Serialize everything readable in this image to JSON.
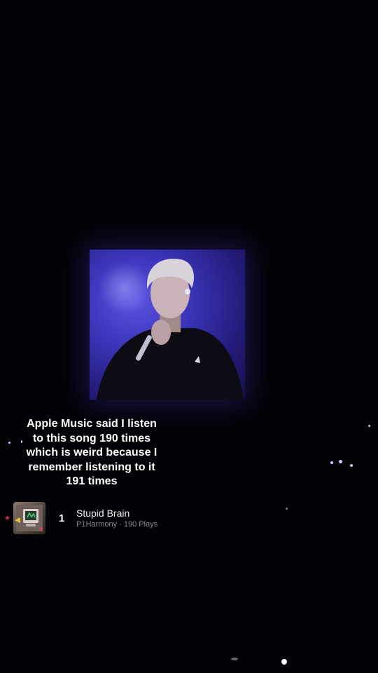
{
  "caption": {
    "line1": "Apple Music said I listen",
    "line2": "to this song 190 times",
    "line3": "which is weird because I",
    "line4": "remember listening to it",
    "line5": "191 times"
  },
  "track": {
    "rank": "1",
    "title": "Stupid Brain",
    "subtitle": "P1Harmony · 190 Plays"
  },
  "icons": {
    "favorite": "star-icon",
    "album": "album-art-icon"
  },
  "colors": {
    "background": "#030206",
    "screen_blue": "#3b34b8",
    "favorite_red": "#e0284a"
  }
}
